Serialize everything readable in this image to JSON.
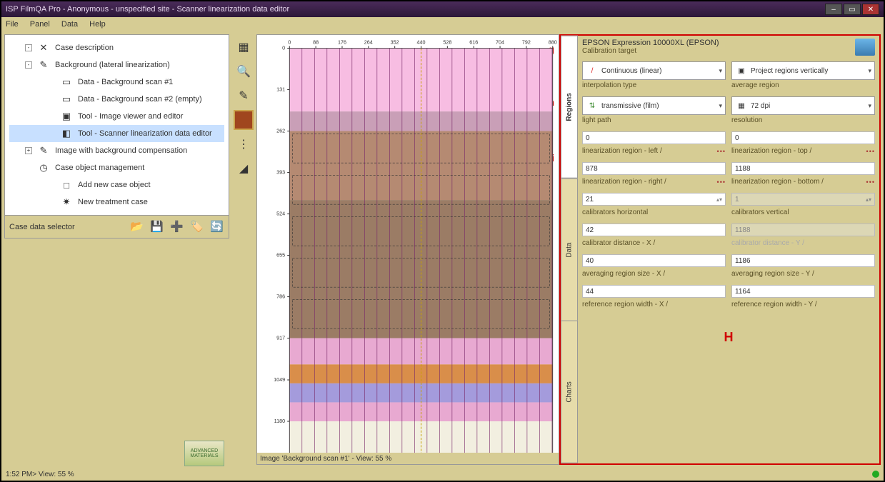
{
  "title": "ISP FilmQA Pro - Anonymous - unspecified site - Scanner linearization data editor",
  "menu": [
    "File",
    "Panel",
    "Data",
    "Help"
  ],
  "tree": {
    "items": [
      {
        "label": "Case description",
        "icon": "✕",
        "indent": 1,
        "exp": "-"
      },
      {
        "label": "Background (lateral linearization)",
        "icon": "✎",
        "indent": 1,
        "exp": "-"
      },
      {
        "label": "Data - Background scan #1",
        "icon": "▭",
        "indent": 2
      },
      {
        "label": "Data - Background scan #2 (empty)",
        "icon": "▭",
        "indent": 2
      },
      {
        "label": "Tool - Image viewer and editor",
        "icon": "▣",
        "indent": 2
      },
      {
        "label": "Tool - Scanner linearization data editor",
        "icon": "◧",
        "indent": 2,
        "active": true
      },
      {
        "label": "Image with background compensation",
        "icon": "✎",
        "indent": 1,
        "exp": "+"
      },
      {
        "label": "Case object management",
        "icon": "◷",
        "indent": 1
      },
      {
        "label": "Add new case object",
        "icon": "□",
        "indent": 2
      },
      {
        "label": "New treatment case",
        "icon": "✷",
        "indent": 2
      }
    ],
    "footer_label": "Case data selector"
  },
  "chart_caption": "Image 'Background scan #1' - View: 55 %",
  "chart_data": {
    "type": "heatmap",
    "xlabel": "",
    "ylabel": "",
    "x_ticks": [
      "0",
      "88",
      "176",
      "264",
      "352",
      "440",
      "528",
      "616",
      "704",
      "792",
      "880"
    ],
    "y_ticks": [
      "0",
      "131",
      "262",
      "393",
      "524",
      "655",
      "786",
      "917",
      "1049",
      "1180",
      "1311"
    ],
    "xlim": [
      0,
      880
    ],
    "ylim": [
      0,
      1311
    ],
    "bands": [
      {
        "y0": 0,
        "y1": 200,
        "color": "#f7bde2"
      },
      {
        "y0": 200,
        "y1": 262,
        "color": "#c99fb7"
      },
      {
        "y0": 262,
        "y1": 480,
        "color": "#b58a72"
      },
      {
        "y0": 480,
        "y1": 917,
        "color": "#9b7c65"
      },
      {
        "y0": 917,
        "y1": 1000,
        "color": "#e8a9d1"
      },
      {
        "y0": 1000,
        "y1": 1060,
        "color": "#d98e4a"
      },
      {
        "y0": 1060,
        "y1": 1120,
        "color": "#a49bdc"
      },
      {
        "y0": 1120,
        "y1": 1180,
        "color": "#e8a9d1"
      },
      {
        "y0": 1180,
        "y1": 1311,
        "color": "#f2efe0"
      }
    ],
    "calibrator_count_x": 21,
    "linearization_left": 0,
    "linearization_right": 878,
    "linearization_top": 0,
    "linearization_bottom": 1188
  },
  "vtabs": [
    {
      "label": "Regions",
      "active": true
    },
    {
      "label": "Data"
    },
    {
      "label": "Charts"
    }
  ],
  "annot": {
    "g": "g",
    "h": "h",
    "i": "i",
    "H": "H"
  },
  "props": {
    "device": "EPSON Expression 10000XL (EPSON)",
    "device_sub": "Calibration target",
    "interp": {
      "value": "Continuous (linear)",
      "label": "interpolation type"
    },
    "region_mode": {
      "value": "Project regions vertically",
      "label": "average region"
    },
    "light": {
      "value": "transmissive (film)",
      "label": "light path"
    },
    "resolution": {
      "value": "72 dpi",
      "label": "resolution"
    },
    "lin_left": {
      "value": "0",
      "label": "linearization region - left /"
    },
    "lin_top": {
      "value": "0",
      "label": "linearization region - top /"
    },
    "lin_right": {
      "value": "878",
      "label": "linearization region - right /"
    },
    "lin_bottom": {
      "value": "1188",
      "label": "linearization region - bottom /"
    },
    "calib_h": {
      "value": "21",
      "label": "calibrators horizontal"
    },
    "calib_v": {
      "value": "1",
      "label": "calibrators vertical"
    },
    "calib_dx": {
      "value": "42",
      "label": "calibrator distance - X /"
    },
    "calib_dy": {
      "value": "1188",
      "label": "calibrator distance - Y /"
    },
    "avg_x": {
      "value": "40",
      "label": "averaging region size - X /"
    },
    "avg_y": {
      "value": "1186",
      "label": "averaging region size - Y /"
    },
    "ref_x": {
      "value": "44",
      "label": "reference region width - X /"
    },
    "ref_y": {
      "value": "1164",
      "label": "reference region width - Y /"
    }
  },
  "logo": "ADVANCED\nMATERIALS",
  "status": "1:52 PM> View: 55 %"
}
